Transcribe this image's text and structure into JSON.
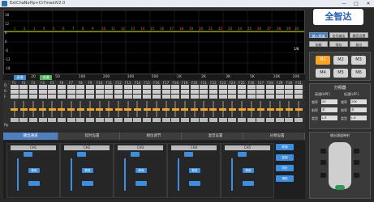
{
  "window": {
    "title": "ExtChaNoHp+Ct7mediV2.0",
    "minimize": "—",
    "maximize": "□",
    "close": "✕"
  },
  "graph": {
    "y_labels": [
      "18",
      "12",
      "6",
      "0",
      "-6",
      "-12",
      "-18"
    ],
    "line_label": "1/8"
  },
  "freq_axis": [
    "20",
    "50",
    "100",
    "200",
    "300",
    "500",
    "1K",
    "2K",
    "3K",
    "5K",
    "10K",
    "20K"
  ],
  "freq_buttons": {
    "a": "高通",
    "b": "低通"
  },
  "logo": {
    "text": "全智达"
  },
  "side_buttons": [
    {
      "label": "输入频道",
      "on": true
    },
    {
      "label": "信号输出",
      "on": false
    },
    {
      "label": "静音设置",
      "on": false
    },
    {
      "label": "加载",
      "on": false
    },
    {
      "label": "保存",
      "on": false
    },
    {
      "label": "复位",
      "on": false
    }
  ],
  "presets": {
    "buttons": [
      {
        "label": "M1",
        "on": true
      },
      {
        "label": "M2",
        "on": false
      },
      {
        "label": "M3",
        "on": false
      },
      {
        "label": "M4",
        "on": false
      },
      {
        "label": "M5",
        "on": false
      },
      {
        "label": "M6",
        "on": false
      }
    ]
  },
  "crossover": {
    "title": "分频器",
    "hp_label": "高通(HPF)",
    "lp_label": "低通(LPF)",
    "rows": [
      {
        "label": "频率",
        "hp": "20",
        "lp": "20K"
      },
      {
        "label": "斜率",
        "hp": "关",
        "lp": "关"
      },
      {
        "label": "类型",
        "hp": "L-R",
        "lp": "L-R"
      }
    ]
  },
  "bands": {
    "labels": [
      "F1",
      "F2",
      "F3",
      "F4",
      "F5",
      "F6",
      "F7",
      "F8",
      "F9",
      "F10",
      "F11",
      "F12",
      "F13",
      "F14",
      "F15",
      "F16",
      "F17",
      "F18",
      "F19",
      "F20",
      "F21",
      "F22",
      "F23",
      "F24",
      "F25",
      "F26",
      "F27",
      "F28",
      "F29",
      "F30",
      "F31"
    ],
    "row_labels": [
      "Q",
      "G",
      "F"
    ],
    "bottom": "Rp"
  },
  "tabs": [
    {
      "label": "输出通道",
      "on": true
    },
    {
      "label": "延时设置",
      "on": false
    },
    {
      "label": "相位调节",
      "on": false
    },
    {
      "label": "混音设置",
      "on": false
    },
    {
      "label": "分频设置",
      "on": false
    }
  ],
  "channels": [
    {
      "name": "CH1",
      "mute": "静音"
    },
    {
      "name": "CH2",
      "mute": "静音"
    },
    {
      "name": "CH3",
      "mute": "静音"
    },
    {
      "name": "CH4",
      "mute": "静音"
    },
    {
      "name": "CH5",
      "mute": "静音"
    }
  ],
  "right_buttons": [
    "联调",
    "复制",
    "同步",
    "清除"
  ],
  "car": {
    "title": "输出通道映射"
  }
}
